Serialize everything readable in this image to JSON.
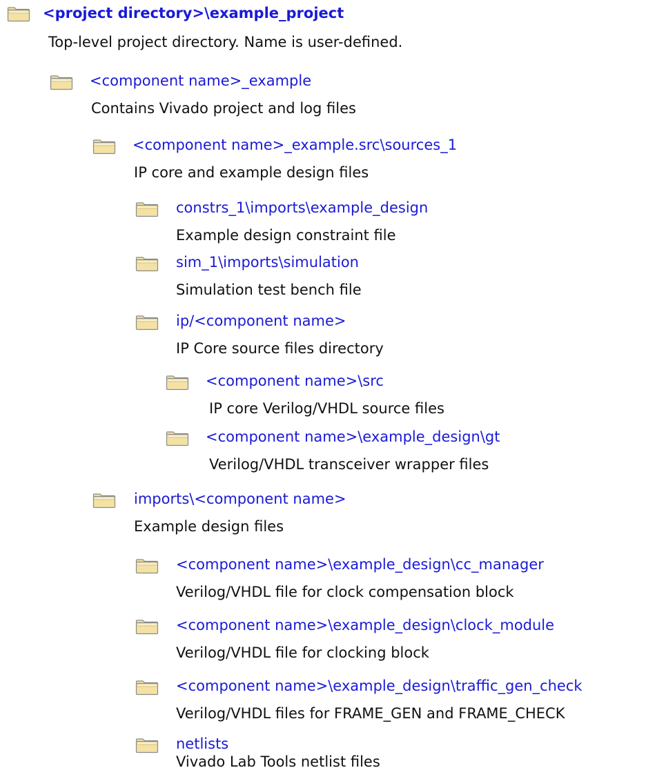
{
  "nodes": [
    {
      "name": "<project directory>\\example_project",
      "description": "Top-level project directory. Name is user-defined.",
      "icon": "folder-icon"
    },
    {
      "name": "<component name>_example",
      "description": "Contains Vivado project and log files",
      "icon": "folder-icon"
    },
    {
      "name": "<component name>_example.src\\sources_1",
      "description": "IP core and example design files",
      "icon": "folder-icon"
    },
    {
      "name": "constrs_1\\imports\\example_design",
      "description": "Example design constraint file",
      "icon": "folder-icon"
    },
    {
      "name": "sim_1\\imports\\simulation",
      "description": "Simulation test bench file",
      "icon": "folder-icon"
    },
    {
      "name": "ip/<component name>",
      "description": "IP Core source files directory",
      "icon": "folder-icon"
    },
    {
      "name": "<component name>\\src",
      "description": "IP core Verilog/VHDL source files",
      "icon": "folder-icon"
    },
    {
      "name": "<component name>\\example_design\\gt",
      "description": "Verilog/VHDL transceiver wrapper files",
      "icon": "folder-icon"
    },
    {
      "name": "imports\\<component name>",
      "description": "Example design files",
      "icon": "folder-icon"
    },
    {
      "name": "<component name>\\example_design\\cc_manager",
      "description": "Verilog/VHDL file for clock compensation block",
      "icon": "folder-icon"
    },
    {
      "name": "<component name>\\example_design\\clock_module",
      "description": "Verilog/VHDL file for clocking block",
      "icon": "folder-icon"
    },
    {
      "name": "<component name>\\example_design\\traffic_gen_check",
      "description": "Verilog/VHDL files for FRAME_GEN and FRAME_CHECK",
      "icon": "folder-icon"
    },
    {
      "name": "netlists",
      "description": "Vivado Lab Tools netlist files",
      "icon": "folder-icon"
    }
  ],
  "colors": {
    "name": "#1a1ad6",
    "description": "#111111",
    "folder_fill": "#f3e2a3",
    "folder_stroke": "#8a8a8a"
  }
}
